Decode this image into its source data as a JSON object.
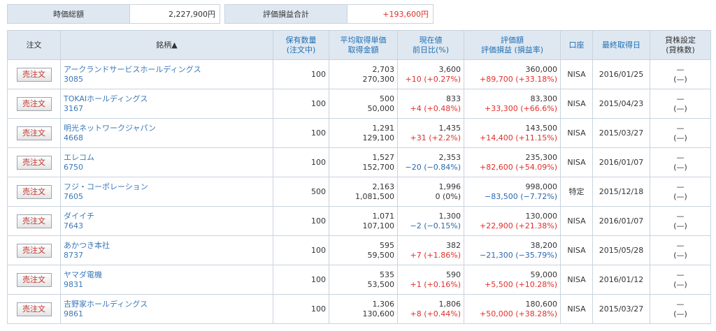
{
  "summary": {
    "market_value_label": "時価総額",
    "market_value": "2,227,900円",
    "pl_total_label": "評価損益合計",
    "pl_total": "+193,600円"
  },
  "columns": {
    "order": "注文",
    "stock": "銘柄▲",
    "qty_1": "保有数量",
    "qty_2": "(注文中)",
    "avg_1": "平均取得単価",
    "avg_2": "取得金額",
    "price_1": "現在値",
    "price_2": "前日比(%)",
    "eval_1": "評価額",
    "eval_2": "評価損益 (損益率)",
    "account": "口座",
    "last_date": "最終取得日",
    "lend_1": "貸株設定",
    "lend_2": "(貸株数)"
  },
  "sell_label": "売注文",
  "rows": [
    {
      "name": "アークランドサービスホールディングス",
      "code": "3085",
      "qty": "100",
      "avg_price": "2,703",
      "cost": "270,300",
      "price": "3,600",
      "change": "+10 (+0.27%)",
      "change_dir": "up",
      "eval": "360,000",
      "pl": "+89,700 (+33.18%)",
      "pl_dir": "up",
      "account": "NISA",
      "date": "2016/01/25",
      "lend": "—",
      "lend_qty": "(—)"
    },
    {
      "name": "TOKAIホールディングス",
      "code": "3167",
      "qty": "100",
      "avg_price": "500",
      "cost": "50,000",
      "price": "833",
      "change": "+4 (+0.48%)",
      "change_dir": "up",
      "eval": "83,300",
      "pl": "+33,300 (+66.6%)",
      "pl_dir": "up",
      "account": "NISA",
      "date": "2015/04/23",
      "lend": "—",
      "lend_qty": "(—)"
    },
    {
      "name": "明光ネットワークジャパン",
      "code": "4668",
      "qty": "100",
      "avg_price": "1,291",
      "cost": "129,100",
      "price": "1,435",
      "change": "+31 (+2.2%)",
      "change_dir": "up",
      "eval": "143,500",
      "pl": "+14,400 (+11.15%)",
      "pl_dir": "up",
      "account": "NISA",
      "date": "2015/03/27",
      "lend": "—",
      "lend_qty": "(—)"
    },
    {
      "name": "エレコム",
      "code": "6750",
      "qty": "100",
      "avg_price": "1,527",
      "cost": "152,700",
      "price": "2,353",
      "change": "−20 (−0.84%)",
      "change_dir": "down",
      "eval": "235,300",
      "pl": "+82,600 (+54.09%)",
      "pl_dir": "up",
      "account": "NISA",
      "date": "2016/01/07",
      "lend": "—",
      "lend_qty": "(—)"
    },
    {
      "name": "フジ・コーポレーション",
      "code": "7605",
      "qty": "500",
      "avg_price": "2,163",
      "cost": "1,081,500",
      "price": "1,996",
      "change": "0 (0%)",
      "change_dir": "zero",
      "eval": "998,000",
      "pl": "−83,500 (−7.72%)",
      "pl_dir": "down",
      "account": "特定",
      "date": "2015/12/18",
      "lend": "—",
      "lend_qty": "(—)"
    },
    {
      "name": "ダイイチ",
      "code": "7643",
      "qty": "100",
      "avg_price": "1,071",
      "cost": "107,100",
      "price": "1,300",
      "change": "−2 (−0.15%)",
      "change_dir": "down",
      "eval": "130,000",
      "pl": "+22,900 (+21.38%)",
      "pl_dir": "up",
      "account": "NISA",
      "date": "2016/01/07",
      "lend": "—",
      "lend_qty": "(—)"
    },
    {
      "name": "あかつき本社",
      "code": "8737",
      "qty": "100",
      "avg_price": "595",
      "cost": "59,500",
      "price": "382",
      "change": "+7 (+1.86%)",
      "change_dir": "up",
      "eval": "38,200",
      "pl": "−21,300 (−35.79%)",
      "pl_dir": "down",
      "account": "NISA",
      "date": "2015/05/28",
      "lend": "—",
      "lend_qty": "(—)"
    },
    {
      "name": "ヤマダ電機",
      "code": "9831",
      "qty": "100",
      "avg_price": "535",
      "cost": "53,500",
      "price": "590",
      "change": "+1 (+0.16%)",
      "change_dir": "up",
      "eval": "59,000",
      "pl": "+5,500 (+10.28%)",
      "pl_dir": "up",
      "account": "NISA",
      "date": "2016/01/12",
      "lend": "—",
      "lend_qty": "(—)"
    },
    {
      "name": "吉野家ホールディングス",
      "code": "9861",
      "qty": "100",
      "avg_price": "1,306",
      "cost": "130,600",
      "price": "1,806",
      "change": "+8 (+0.44%)",
      "change_dir": "up",
      "eval": "180,600",
      "pl": "+50,000 (+38.28%)",
      "pl_dir": "up",
      "account": "NISA",
      "date": "2015/03/27",
      "lend": "—",
      "lend_qty": "(—)"
    }
  ]
}
